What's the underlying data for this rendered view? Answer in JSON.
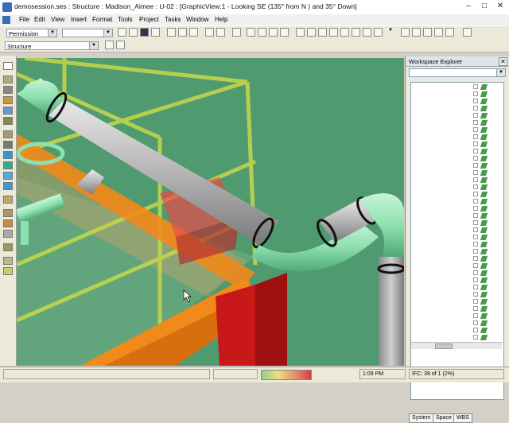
{
  "window": {
    "title": "demosession.ses : Structure : Madison_Aimee : U-02 : [GraphicView:1 - Looking SE (135° from N ) and 35° Down]",
    "minimize": "–",
    "maximize": "□",
    "close": "✕"
  },
  "menu": [
    "File",
    "Edit",
    "View",
    "Insert",
    "Format",
    "Tools",
    "Project",
    "Tasks",
    "Window",
    "Help"
  ],
  "toolbar": {
    "permission_group_label": "Permission Group",
    "permission_group_value": "",
    "task_combo": "Structure"
  },
  "explorer": {
    "title": "Workspace Explorer",
    "tabs": [
      "System",
      "Space",
      "WBS"
    ]
  },
  "status": {
    "time": "1:09 PM",
    "ifc": "IFC: 39 of 1 (2%)"
  },
  "colors": {
    "background_green": "#4f9a6f",
    "pipe_green": "#8fe0b0",
    "pipe_gray": "#b8b8b8",
    "beam_orange": "#f08a1a",
    "beam_red": "#c81818",
    "rail_yellow": "#c8d84a"
  }
}
